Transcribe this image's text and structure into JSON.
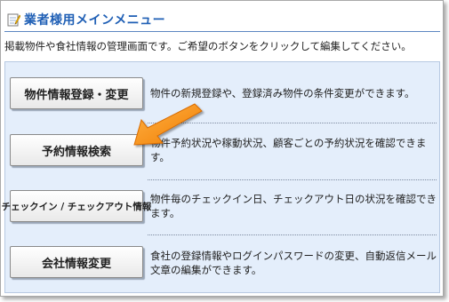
{
  "header": {
    "title": "業者様用メインメニュー",
    "icon": "notepad-pencil-icon"
  },
  "intro_text": "掲載物件や食社情報の管理画面です。ご希望のボタンをクリックして編集してください。",
  "menu": [
    {
      "button_label": "物件情報登録・変更",
      "description": "物件の新規登録や、登録済み物件の条件変更ができます。"
    },
    {
      "button_label": "予約情報検索",
      "description": "物件予約状況や稼動状況、顧客ごとの予約状況を確認できます。"
    },
    {
      "button_label": "チェックイン / チェックアウト情報",
      "description": "物件毎のチェックイン日、チェックアウト日の状況を確認できます。"
    },
    {
      "button_label": "会社情報変更",
      "description_line1": "食社の登録情報やログインパスワードの変更、自動返信メール",
      "description_line2": "文章の編集ができます。"
    }
  ],
  "colors": {
    "title": "#1f5fb5",
    "panel_bg": "#e4eefb",
    "arrow": "#f7941d"
  }
}
